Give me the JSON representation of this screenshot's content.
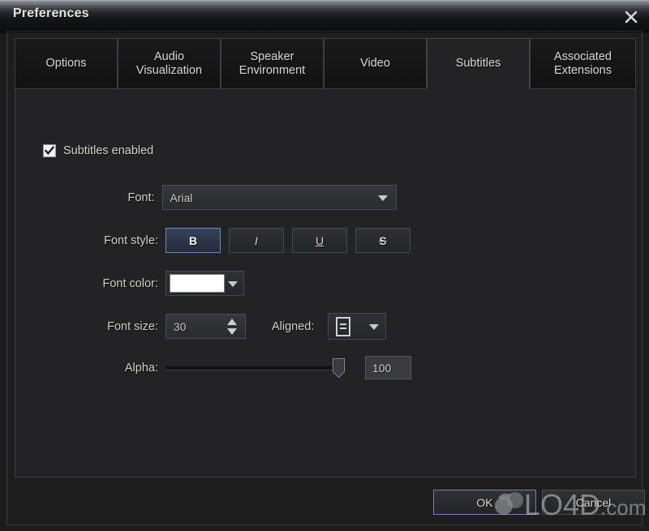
{
  "window": {
    "title": "Preferences",
    "close_icon": "close-icon"
  },
  "tabs": [
    {
      "label": "Options",
      "selected": false
    },
    {
      "label": "Audio\nVisualization",
      "selected": false
    },
    {
      "label": "Speaker\nEnvironment",
      "selected": false
    },
    {
      "label": "Video",
      "selected": false
    },
    {
      "label": "Subtitles",
      "selected": true
    },
    {
      "label": "Associated\nExtensions",
      "selected": false
    }
  ],
  "subtitles_panel": {
    "enabled_checkbox": {
      "label": "Subtitles enabled",
      "checked": true
    },
    "font": {
      "label": "Font:",
      "value": "Arial"
    },
    "font_style": {
      "label": "Font style:",
      "buttons": [
        {
          "label": "B",
          "name": "bold",
          "active": true
        },
        {
          "label": "I",
          "name": "italic",
          "active": false
        },
        {
          "label": "U",
          "name": "underline",
          "active": false
        },
        {
          "label": "S",
          "name": "strikethrough",
          "active": false
        }
      ]
    },
    "font_color": {
      "label": "Font color:",
      "value": "#FFFFFF"
    },
    "font_size": {
      "label": "Font size:",
      "value": "30"
    },
    "aligned": {
      "label": "Aligned:",
      "icon": "align-center-icon"
    },
    "alpha": {
      "label": "Alpha:",
      "value": "100",
      "slider_percent": 100
    }
  },
  "footer": {
    "ok_label": "OK",
    "cancel_label": "Cancel"
  },
  "watermark": {
    "text": "LO4D",
    "suffix": ".com"
  },
  "colors": {
    "window_bg": "#1c1c1c",
    "panel_bg": "#232325",
    "tab_bg": "#161617",
    "border": "#3c3e42",
    "label_text": "#d4d0c6",
    "accent_blue": "#6e86ad",
    "swatch": "#FFFFFF"
  }
}
